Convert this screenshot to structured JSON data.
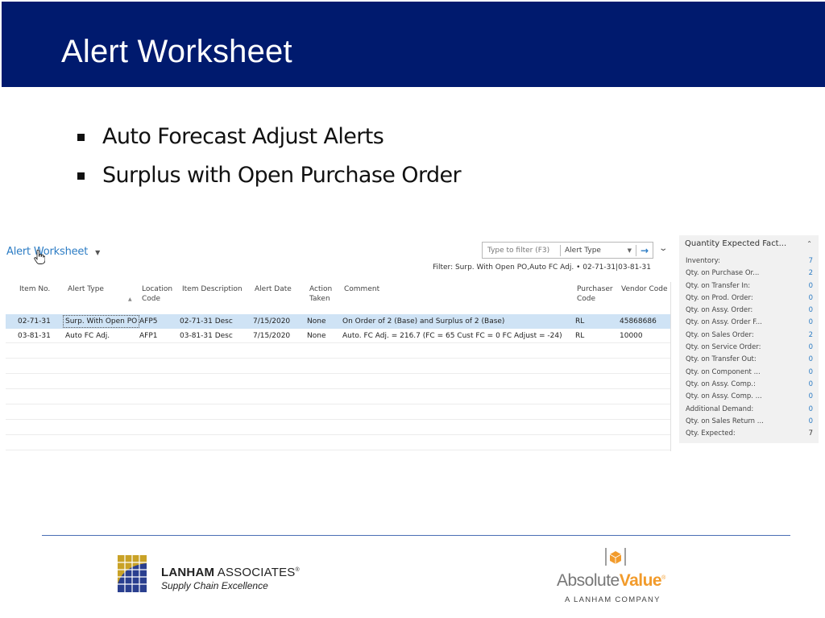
{
  "slide": {
    "title": "Alert Worksheet",
    "bullets": [
      "Auto Forecast Adjust Alerts",
      "Surplus with Open Purchase Order"
    ]
  },
  "page": {
    "caption": "Alert Worksheet",
    "filter": {
      "placeholder": "Type to filter (F3)",
      "field": "Alert Type",
      "applied_text": "Filter: Surp. With Open PO,Auto FC Adj. • 02-71-31|03-81-31"
    },
    "columns": [
      {
        "key": "item_no",
        "label": "Item No."
      },
      {
        "key": "alert_type",
        "label": "Alert Type"
      },
      {
        "key": "location_code",
        "label": "Location Code"
      },
      {
        "key": "item_description",
        "label": "Item Description"
      },
      {
        "key": "alert_date",
        "label": "Alert Date"
      },
      {
        "key": "action_taken",
        "label": "Action Taken"
      },
      {
        "key": "comment",
        "label": "Comment"
      },
      {
        "key": "purchaser_code",
        "label": "Purchaser Code"
      },
      {
        "key": "vendor_code",
        "label": "Vendor Code"
      }
    ],
    "rows": [
      {
        "item_no": "02-71-31",
        "alert_type": "Surp. With Open PO",
        "location_code": "AFP5",
        "item_description": "02-71-31 Desc",
        "alert_date": "7/15/2020",
        "action_taken": "None",
        "comment": "On Order of 2 (Base) and Surplus of 2 (Base)",
        "purchaser_code": "RL",
        "vendor_code": "45868686"
      },
      {
        "item_no": "03-81-31",
        "alert_type": "Auto FC Adj.",
        "location_code": "AFP1",
        "item_description": "03-81-31 Desc",
        "alert_date": "7/15/2020",
        "action_taken": "None",
        "comment": "Auto. FC Adj. = 216.7  (FC = 65  Cust FC = 0  FC Adjust = -24)",
        "purchaser_code": "RL",
        "vendor_code": "10000"
      }
    ]
  },
  "factbox": {
    "title": "Quantity Expected Fact...",
    "items": [
      {
        "label": "Inventory:",
        "value": "7"
      },
      {
        "label": "Qty. on Purchase Or...",
        "value": "2"
      },
      {
        "label": "Qty. on Transfer In:",
        "value": "0"
      },
      {
        "label": "Qty. on Prod. Order:",
        "value": "0"
      },
      {
        "label": "Qty. on Assy. Order:",
        "value": "0"
      },
      {
        "label": "Qty. on Assy. Order F...",
        "value": "0"
      },
      {
        "label": "Qty. on Sales Order:",
        "value": "2"
      },
      {
        "label": "Qty. on Service Order:",
        "value": "0"
      },
      {
        "label": "Qty. on Transfer Out:",
        "value": "0"
      },
      {
        "label": "Qty. on Component ...",
        "value": "0"
      },
      {
        "label": "Qty. on Assy. Comp.:",
        "value": "0"
      },
      {
        "label": "Qty. on Assy. Comp. ...",
        "value": "0"
      },
      {
        "label": "Additional Demand:",
        "value": "0"
      },
      {
        "label": "Qty. on Sales Return ...",
        "value": "0"
      },
      {
        "label": "Qty. Expected:",
        "value": "7"
      }
    ]
  },
  "footer": {
    "lanham": {
      "name_bold": "LANHAM",
      "name_rest": " ASSOCIATES",
      "reg": "®",
      "tagline": "Supply Chain Excellence"
    },
    "absolute_value": {
      "part1": "Absolute",
      "part2": "Value",
      "reg": "®",
      "subtitle": "A LANHAM COMPANY"
    }
  },
  "colors": {
    "header_bg": "#001a6e",
    "link_blue": "#2c7cc4",
    "selected_row": "#cfe3f5",
    "av_orange": "#f29b2b"
  }
}
